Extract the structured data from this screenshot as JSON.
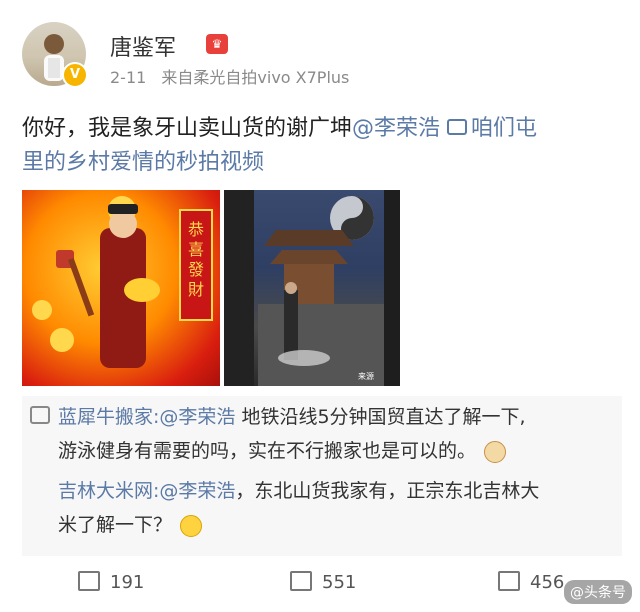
{
  "user": {
    "name": "唐鉴军",
    "date": "2-11",
    "source": "来自柔光自拍vivo X7Plus"
  },
  "post": {
    "text_line1": "你好，我是象牙山卖山货的谢广坤",
    "mention": "@李荣浩",
    "video_link": "咱们屯",
    "text_line2": "里的乡村爱情的秒拍视频"
  },
  "comments": [
    {
      "name": "蓝犀牛搬家",
      "mention": ":@李荣浩",
      "text_a": " 地铁沿线5分钟国贸直达了解一下,",
      "text_b": "游泳健身有需要的吗，实在不行搬家也是可以的。"
    },
    {
      "name": "吉林大米网",
      "mention": ":@李荣浩",
      "text_a": "，东北山货我家有，正宗东北吉林大",
      "text_b": "米了解一下？"
    }
  ],
  "actions": {
    "repost": "191",
    "comment": "551",
    "like": "456"
  },
  "images": {
    "img1_banner": "恭喜發財",
    "img2_watermark": "来源"
  },
  "watermark": "@头条号"
}
